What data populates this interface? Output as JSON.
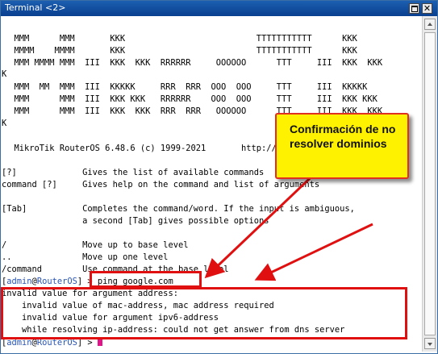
{
  "window": {
    "title": "Terminal <2>",
    "close_label": "✕"
  },
  "terminal": {
    "lines": [
      "",
      "  MMM      MMM       KKK                          TTTTTTTTTTT      KKK",
      "  MMMM    MMMM       KKK                          TTTTTTTTTTT      KKK",
      "  MMM MMMM MMM  III  KKK  KKK  RRRRRR     OOOOOO      TTT     III  KKK  KKK",
      "K",
      "  MMM  MM  MMM  III  KKKKK     RRR  RRR  OOO  OOO     TTT     III  KKKKK",
      "  MMM      MMM  III  KKK KKK   RRRRRR    OOO  OOO     TTT     III  KKK KKK",
      "  MMM      MMM  III  KKK  KKK  RRR  RRR   OOOOOO      TTT     III  KKK  KKK",
      "K",
      "",
      "  MikroTik RouterOS 6.48.6 (c) 1999-2021       http://www.mikrotik.com/",
      "",
      "[?]             Gives the list of available commands",
      "command [?]     Gives help on the command and list of arguments",
      "",
      "[Tab]           Completes the command/word. If the input is ambiguous,",
      "                a second [Tab] gives possible options",
      "",
      "/               Move up to base level",
      "..              Move up one level",
      "/command        Use command at the base level"
    ],
    "prompt_user": "admin",
    "prompt_at": "@",
    "prompt_host": "RouterOS",
    "prompt_suffix": "] > ",
    "prompt_open": "[",
    "command": "ping google.com",
    "error_lines": [
      "invalid value for argument address:",
      "    invalid value of mac-address, mac address required",
      "    invalid value for argument ipv6-address",
      "    while resolving ip-address: could not get answer from dns server"
    ]
  },
  "annotation": {
    "callout_text": "Confirmación de no resolver dominios"
  },
  "colors": {
    "titlebar": "#0a3f8f",
    "callout_fill": "#fff200",
    "highlight": "#e01010",
    "prompt": "#2a55b5",
    "cursor": "#e3148a"
  }
}
